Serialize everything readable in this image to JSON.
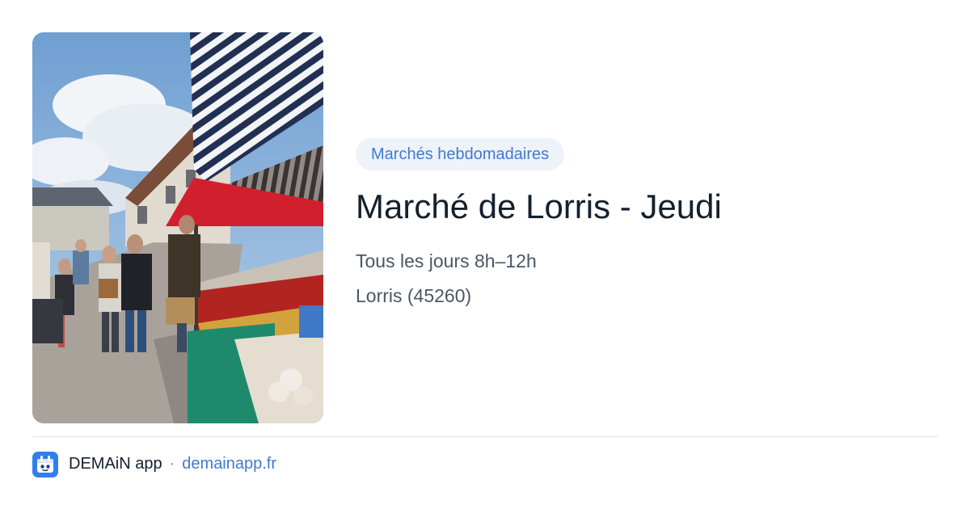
{
  "badge": {
    "label": "Marchés hebdomadaires"
  },
  "market": {
    "title": "Marché de Lorris - Jeudi",
    "schedule": "Tous les jours 8h–12h",
    "location": "Lorris (45260)"
  },
  "footer": {
    "app_name": "DEMAiN app",
    "separator": "·",
    "url": "demainapp.fr"
  },
  "photo": {
    "alt": "Marché de Lorris - Jeudi"
  },
  "icons": {
    "app_logo": "demain-app-logo-icon"
  },
  "colors": {
    "accent": "#3f7ad1",
    "badge_background": "#eef3fa",
    "title": "#14202e",
    "muted_text": "#4b5667",
    "logo_background": "#2f7ff0"
  }
}
